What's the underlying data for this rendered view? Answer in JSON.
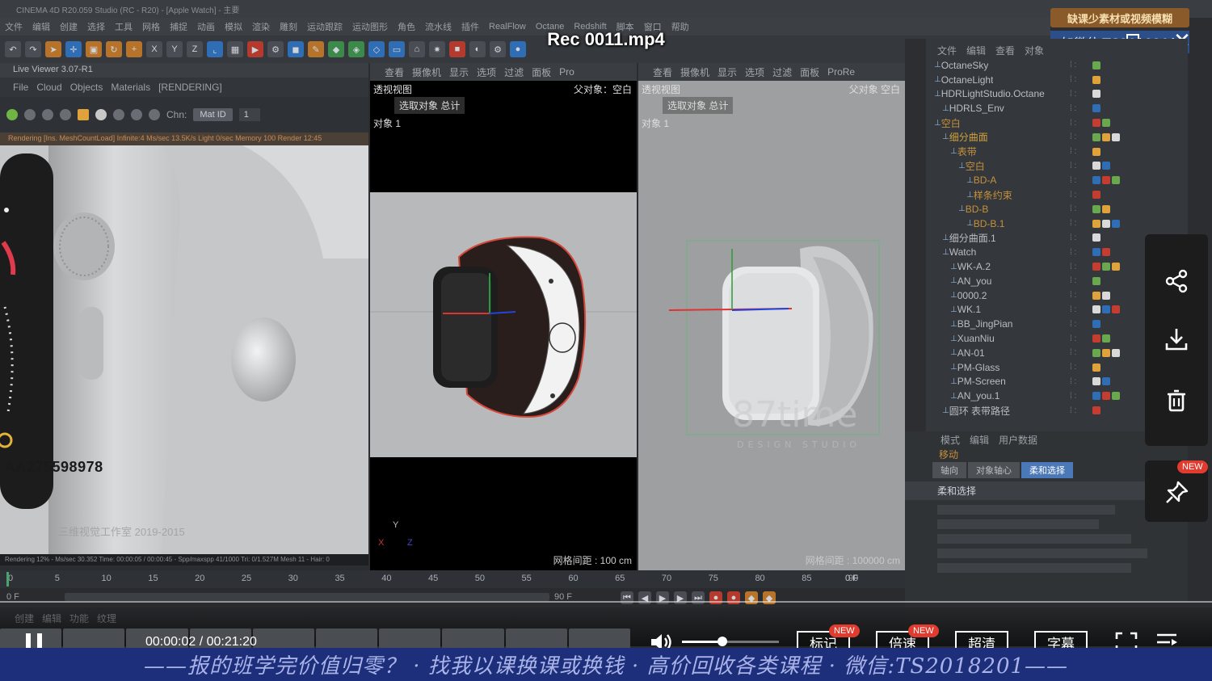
{
  "window": {
    "title_bar": "CINEMA 4D R20.059 Studio (RC - R20) - [Apple Watch] - 主要",
    "menu": [
      "文件",
      "编辑",
      "创建",
      "选择",
      "工具",
      "网格",
      "捕捉",
      "动画",
      "模拟",
      "渲染",
      "雕刻",
      "运动跟踪",
      "运动图形",
      "角色",
      "流水线",
      "插件",
      "RealFlow",
      "Octane",
      "Redshift",
      "脚本",
      "窗口",
      "帮助"
    ],
    "video_title": "Rec 0011.mp4"
  },
  "watermark": {
    "top_label": "缺课少素材或视频模糊",
    "wechat_id": "加微信 TS2018201"
  },
  "live_viewer": {
    "header": "Live Viewer 3.07-R1",
    "menu": [
      "File",
      "Cloud",
      "Objects",
      "Materials",
      "[RENDERING]"
    ],
    "channel_label": "Chn:",
    "channel_value": "Mat ID",
    "number_value": "1",
    "status": "Rendering [Ins. MeshCountLoad] Infinite:4 Ms/sec 13.5K/s Light 0/sec Memory 100 Render 12:45",
    "bottom_status": "Rendering 12% - Ms/sec 30.352 Time: 00:00:05 / 00:00:45 - Spp/maxspp 41/1000 Tri: 0/1.527M Mesh 11 - Hair: 0",
    "overlay_id": "AA275598978",
    "overlay_copyright": "三维视觉工作室 2019-2015"
  },
  "viewport_left": {
    "menu": [
      "查看",
      "摄像机",
      "显示",
      "选项",
      "过滤",
      "面板",
      "Pro"
    ],
    "label": "透视视图",
    "parent": "父对象：空白",
    "info": "选取对象 总计",
    "object_count": "对象   1",
    "grid": "网格间距 : 100 cm",
    "axes": [
      "Y",
      "X",
      "Z"
    ]
  },
  "viewport_right": {
    "menu": [
      "查看",
      "摄像机",
      "显示",
      "选项",
      "过滤",
      "面板",
      "ProRe"
    ],
    "label": "透视视图",
    "parent": "父对象   空白",
    "info": "选取对象 总计",
    "object_count": "对象   1",
    "grid": "网格间距 : 100000 cm",
    "watermark_text": "87time",
    "watermark_sub": "DESIGN STUDIO"
  },
  "object_manager": {
    "menu": [
      "文件",
      "编辑",
      "查看",
      "对象"
    ],
    "rows": [
      {
        "name": "OctaneSky",
        "indent": 0,
        "color": "#b9bec4"
      },
      {
        "name": "OctaneLight",
        "indent": 0,
        "color": "#b9bec4"
      },
      {
        "name": "HDRLightStudio.Octane",
        "indent": 0,
        "color": "#b9bec4"
      },
      {
        "name": "HDRLS_Env",
        "indent": 1,
        "color": "#b9bec4"
      },
      {
        "name": "空白",
        "indent": 0,
        "color": "#c6913b"
      },
      {
        "name": "细分曲面",
        "indent": 1,
        "color": "#d0a13d"
      },
      {
        "name": "表带",
        "indent": 2,
        "color": "#c6913b"
      },
      {
        "name": "空白",
        "indent": 3,
        "color": "#c6913b"
      },
      {
        "name": "BD-A",
        "indent": 4,
        "color": "#c6913b"
      },
      {
        "name": "样条约束",
        "indent": 4,
        "color": "#c6913b"
      },
      {
        "name": "BD-B",
        "indent": 3,
        "color": "#c6913b"
      },
      {
        "name": "BD-B.1",
        "indent": 4,
        "color": "#c6913b"
      },
      {
        "name": "细分曲面.1",
        "indent": 1,
        "color": "#b9bec4"
      },
      {
        "name": "Watch",
        "indent": 1,
        "color": "#b9bec4"
      },
      {
        "name": "WK-A.2",
        "indent": 2,
        "color": "#b9bec4"
      },
      {
        "name": "AN_you",
        "indent": 2,
        "color": "#b9bec4"
      },
      {
        "name": "0000.2",
        "indent": 2,
        "color": "#b9bec4"
      },
      {
        "name": "WK.1",
        "indent": 2,
        "color": "#b9bec4"
      },
      {
        "name": "BB_JingPian",
        "indent": 2,
        "color": "#b9bec4"
      },
      {
        "name": "XuanNiu",
        "indent": 2,
        "color": "#b9bec4"
      },
      {
        "name": "AN-01",
        "indent": 2,
        "color": "#b9bec4"
      },
      {
        "name": "PM-Glass",
        "indent": 2,
        "color": "#b9bec4"
      },
      {
        "name": "PM-Screen",
        "indent": 2,
        "color": "#b9bec4"
      },
      {
        "name": "AN_you.1",
        "indent": 2,
        "color": "#b9bec4"
      },
      {
        "name": "圆环 表带路径",
        "indent": 1,
        "color": "#b9bec4"
      }
    ]
  },
  "attribute_manager": {
    "menu": [
      "模式",
      "编辑",
      "用户数据"
    ],
    "title": "移动",
    "tabs": [
      "轴向",
      "对象轴心",
      "柔和选择"
    ],
    "section": "柔和选择"
  },
  "timeline": {
    "ticks": [
      "0",
      "5",
      "10",
      "15",
      "20",
      "25",
      "30",
      "35",
      "40",
      "45",
      "50",
      "55",
      "60",
      "65",
      "70",
      "75",
      "80",
      "85",
      "90"
    ],
    "current_frame": "0 F",
    "end_frame": "90 F",
    "start_field": "0 F"
  },
  "material_bar": {
    "menu": [
      "创建",
      "编辑",
      "功能",
      "纹理"
    ]
  },
  "player": {
    "current_time": "00:00:02",
    "total_time": "00:21:20",
    "buttons": [
      "标记",
      "倍速",
      "超清",
      "字幕"
    ],
    "new_badge": "NEW",
    "volume_level": 0.42,
    "progress": 0.002
  },
  "side_actions": {
    "share": "share-icon",
    "download": "download-icon",
    "delete": "trash-icon",
    "pin": "pin-icon",
    "new_badge": "NEW"
  },
  "banner": {
    "text": "——报的班学完价值归零？ · 找我以课换课或换钱 · 高价回收各类课程 · 微信:TS2018201——"
  }
}
